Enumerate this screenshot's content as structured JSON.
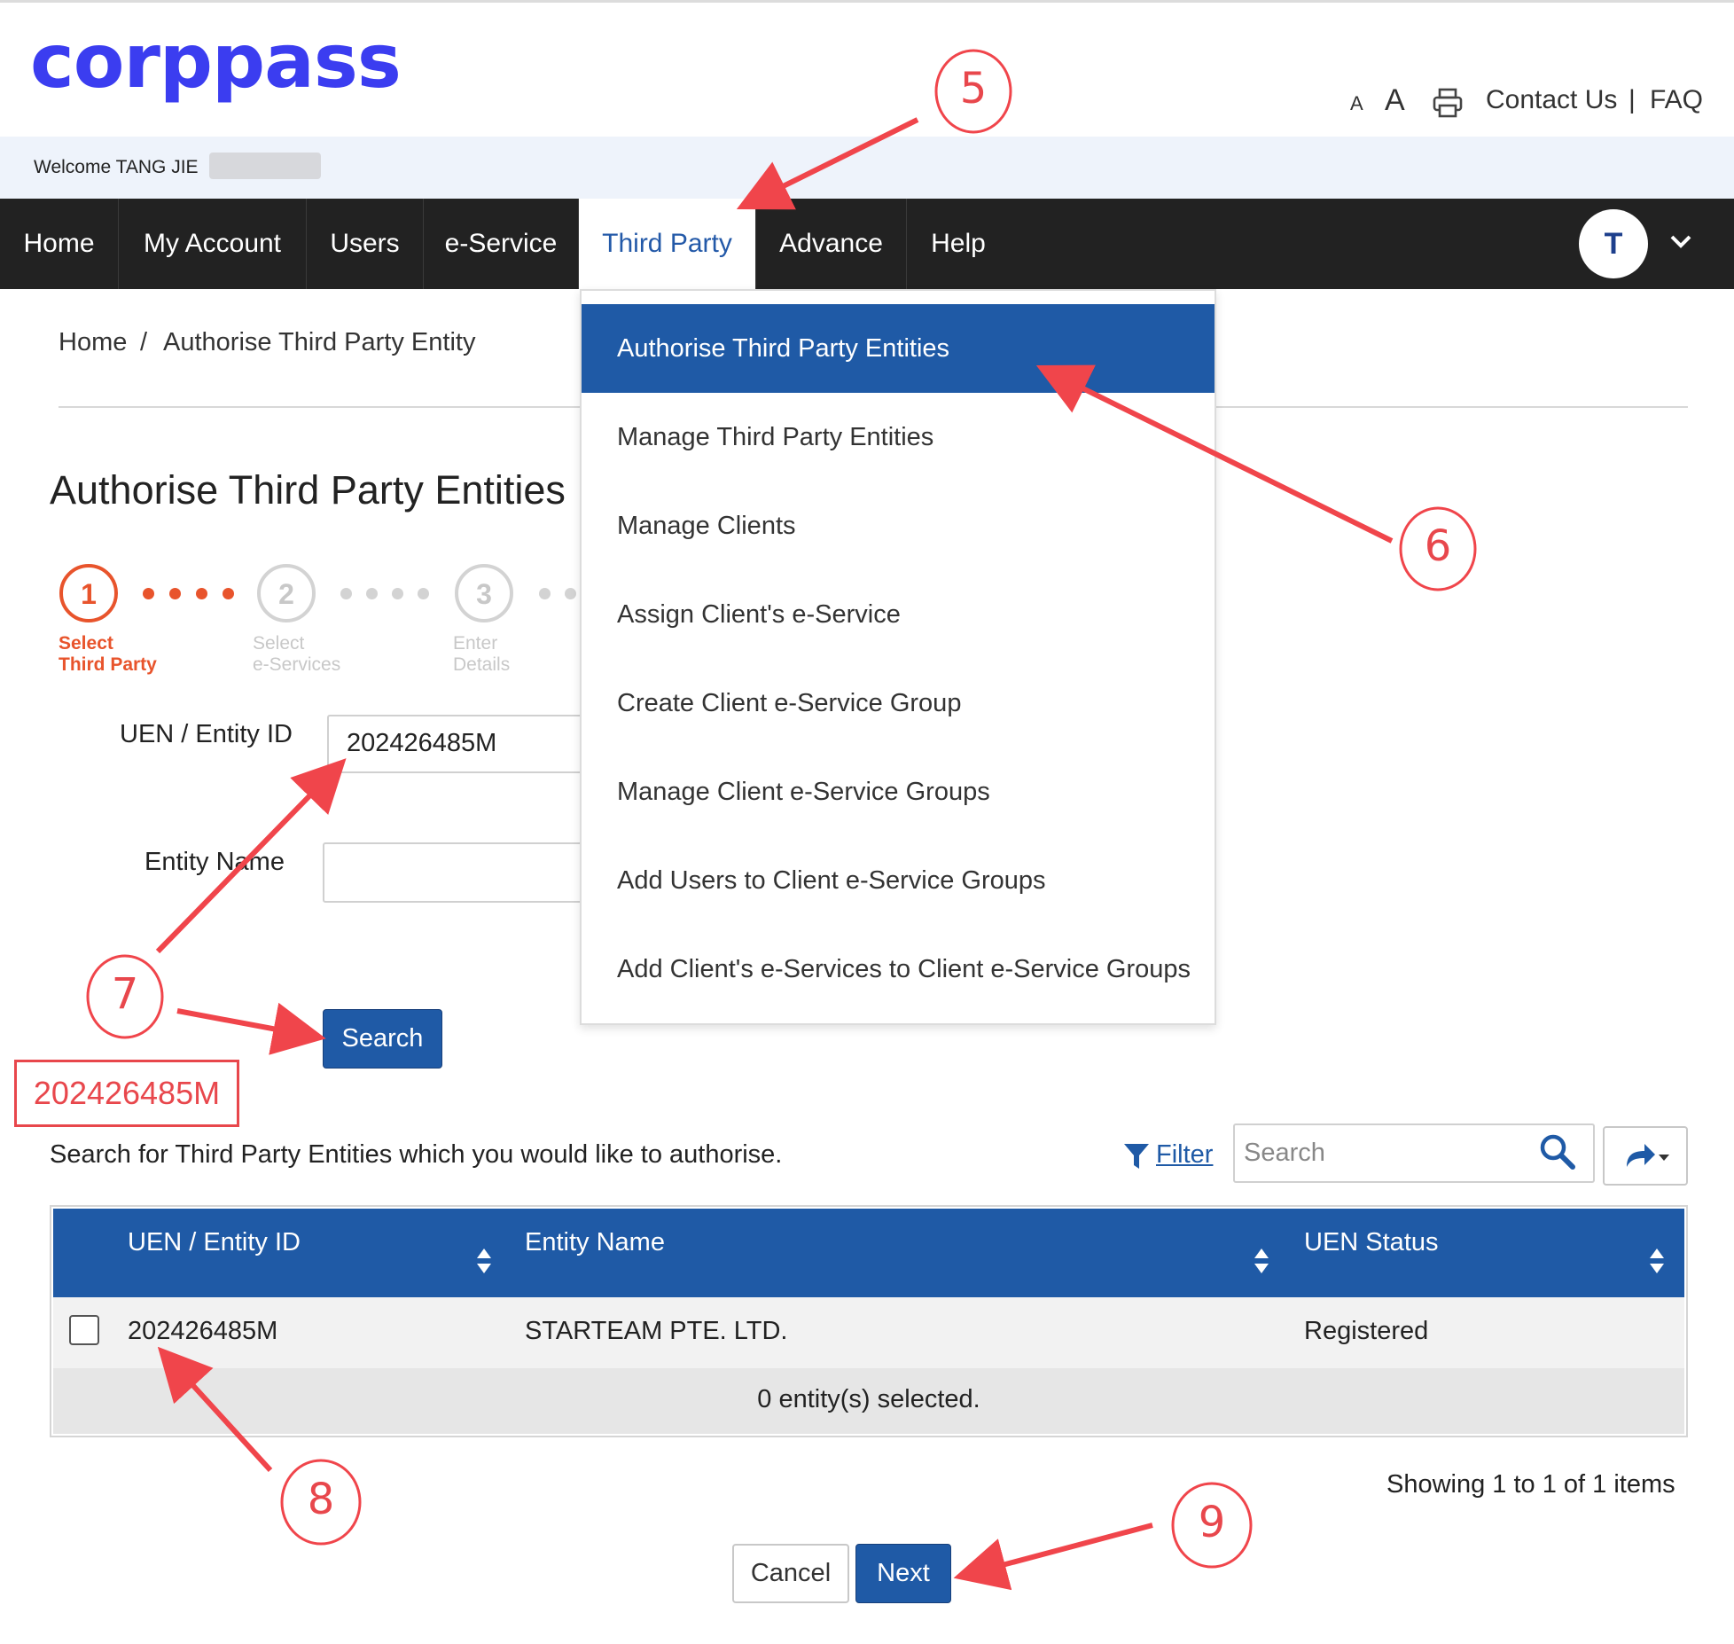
{
  "header": {
    "logo": "corppass",
    "font_small": "A",
    "font_large": "A",
    "contact": "Contact Us",
    "separator": "|",
    "faq": "FAQ"
  },
  "welcome": {
    "text": "Welcome TANG JIE"
  },
  "nav": {
    "items": [
      "Home",
      "My Account",
      "Users",
      "e-Service",
      "Third Party",
      "Advance",
      "Help"
    ],
    "active": "Third Party",
    "avatar_initial": "T"
  },
  "dropdown": {
    "items": [
      "Authorise Third Party Entities",
      "Manage Third Party Entities",
      "Manage Clients",
      "Assign Client's e-Service",
      "Create Client e-Service Group",
      "Manage Client e-Service Groups",
      "Add Users to Client e-Service Groups",
      "Add Client's e-Services to Client e-Service Groups"
    ],
    "active": "Authorise Third Party Entities"
  },
  "breadcrumb": {
    "home": "Home",
    "sep": "/",
    "current": "Authorise Third Party Entity"
  },
  "page": {
    "title": "Authorise Third Party Entities"
  },
  "stepper": {
    "steps": [
      {
        "num": "1",
        "line1": "Select",
        "line2": "Third Party",
        "state": "active"
      },
      {
        "num": "2",
        "line1": "Select",
        "line2": "e-Services",
        "state": "inactive"
      },
      {
        "num": "3",
        "line1": "Enter",
        "line2": "Details",
        "state": "inactive"
      }
    ]
  },
  "form": {
    "uen_label": "UEN / Entity ID",
    "uen_value": "202426485M",
    "name_label": "Entity Name",
    "name_value": "",
    "search_button": "Search"
  },
  "annotation_box": "202426485M",
  "results": {
    "hint": "Search for Third Party Entities which you would like to authorise.",
    "filter": "Filter",
    "search_placeholder": "Search",
    "columns": [
      "UEN / Entity ID",
      "Entity Name",
      "UEN Status"
    ],
    "rows": [
      {
        "uen": "202426485M",
        "name": "STARTEAM PTE. LTD.",
        "status": "Registered"
      }
    ],
    "selected": "0 entity(s) selected.",
    "pagination": "Showing 1 to 1 of 1 items"
  },
  "actions": {
    "cancel": "Cancel",
    "next": "Next"
  },
  "callouts": [
    "5",
    "6",
    "7",
    "8",
    "9"
  ],
  "colors": {
    "brand_blue": "#1f5aa6",
    "logo_blue": "#3b3df0",
    "nav_bg": "#222222",
    "step_active": "#e8542c",
    "annotation_red": "#e8474c"
  }
}
